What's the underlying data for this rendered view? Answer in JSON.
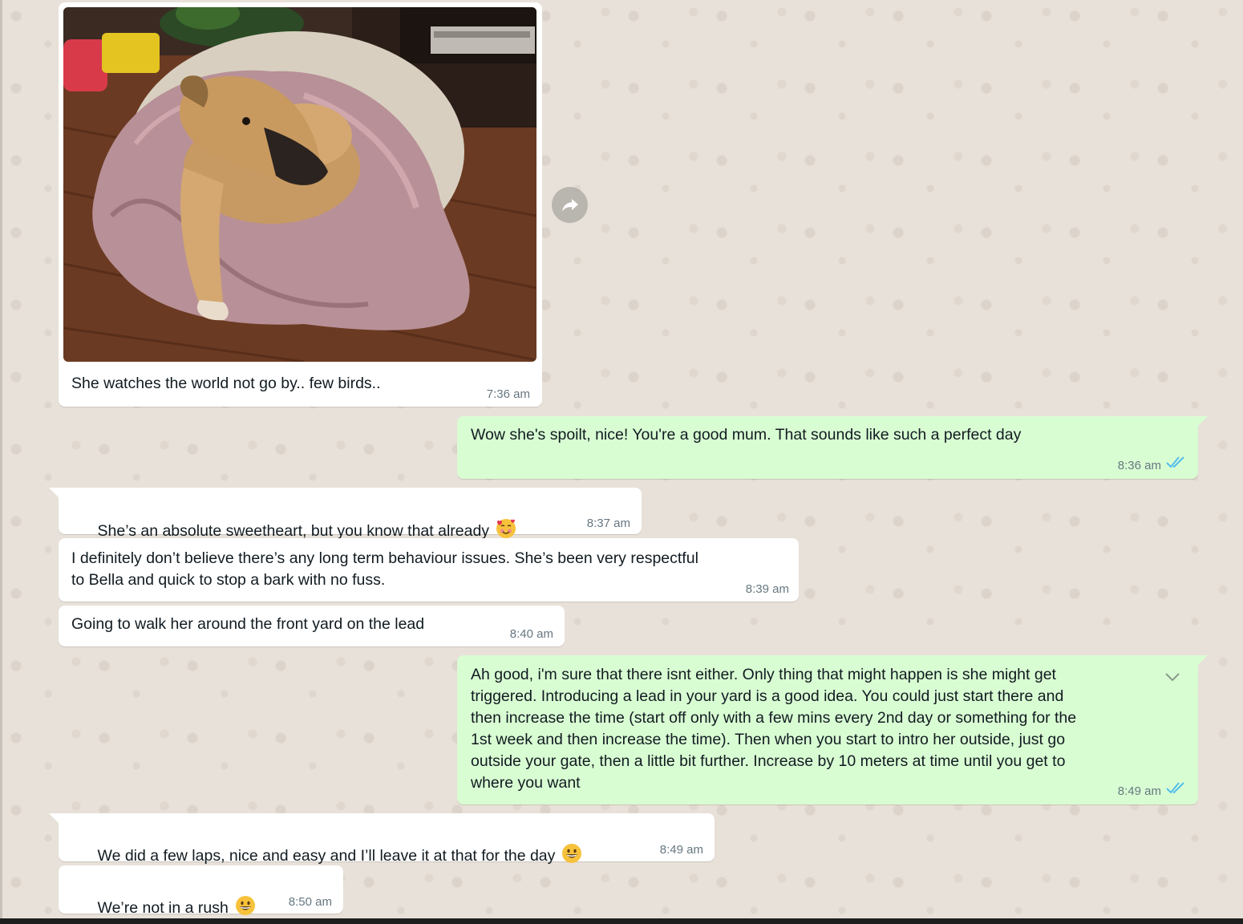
{
  "colors": {
    "incoming_bubble": "#ffffff",
    "outgoing_bubble": "#d9fdd3",
    "read_ticks": "#53bdeb",
    "timestamp": "#667781"
  },
  "messages": [
    {
      "id": "m1",
      "direction": "incoming",
      "type": "image",
      "image": "photo of a tan dog lying on a pink blanket on a round dog bed",
      "text": "She watches the world not go by.. few birds..",
      "time": "7:36 am"
    },
    {
      "id": "m2",
      "direction": "outgoing",
      "text": "Wow she's spoilt, nice! You're a good mum. That sounds like such a perfect day",
      "time": "8:36 am",
      "status": "read"
    },
    {
      "id": "m3",
      "direction": "incoming",
      "text": "She’s an absolute sweetheart, but you know that already",
      "emoji": "smiling-face-with-hearts",
      "time": "8:37 am"
    },
    {
      "id": "m4",
      "direction": "incoming",
      "text": "I definitely don’t believe there’s any long term behaviour issues. She’s been very respectful\nto Bella and quick to stop a bark with no fuss.",
      "time": "8:39 am"
    },
    {
      "id": "m5",
      "direction": "incoming",
      "text": "Going to walk her around the front yard on the lead",
      "time": "8:40 am"
    },
    {
      "id": "m6",
      "direction": "outgoing",
      "text": "Ah good, i'm sure that there isnt either. Only thing that might happen is she might get\ntriggered. Introducing a lead in your yard is a good idea. You could just start there and\nthen increase the time (start off only with a few mins every 2nd day or something for the\n1st week and then increase the time). Then when you start to intro her outside, just go\noutside your gate, then a little bit further. Increase by 10 meters at time until you get to\nwhere you want",
      "time": "8:49 am",
      "status": "read"
    },
    {
      "id": "m7",
      "direction": "incoming",
      "text": "We did a few laps, nice and easy and I’ll leave it at that for the day",
      "emoji": "grinning-face",
      "time": "8:49 am"
    },
    {
      "id": "m8",
      "direction": "incoming",
      "text": "We’re not in a rush",
      "emoji": "grinning-face",
      "time": "8:50 am"
    }
  ]
}
